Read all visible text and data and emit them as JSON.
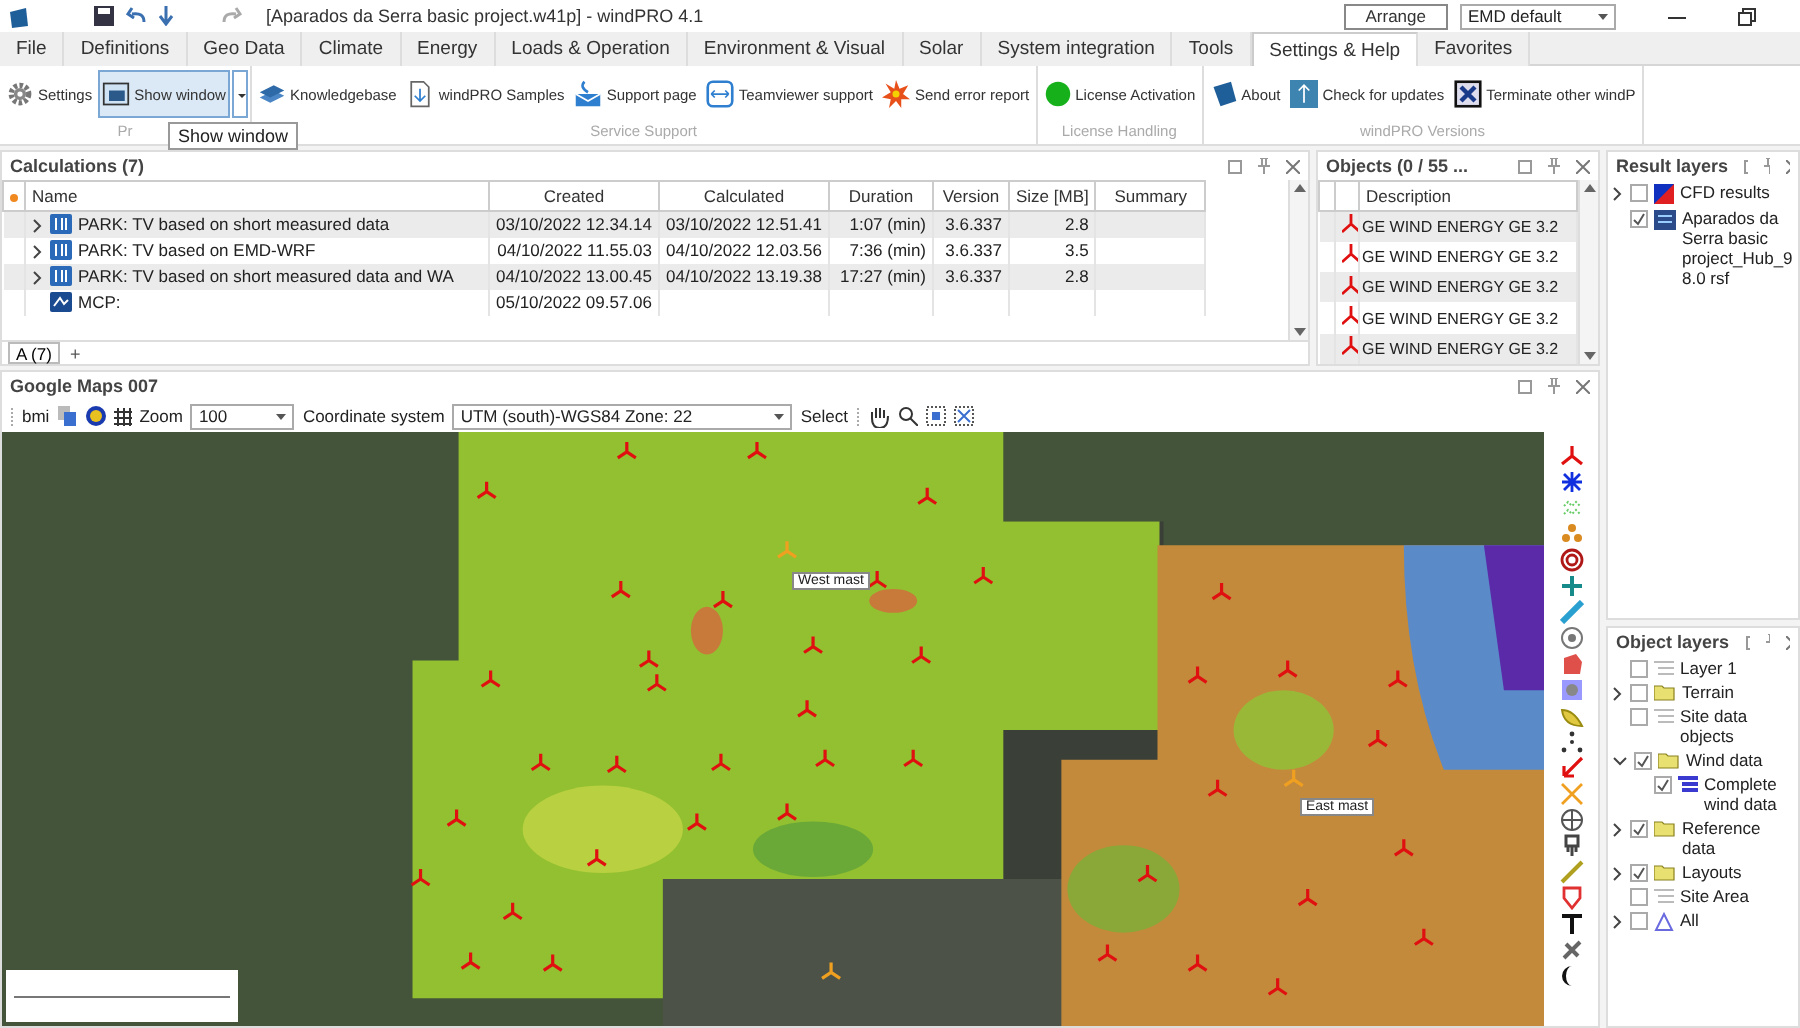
{
  "window": {
    "title": "[Aparados da Serra basic project.w41p] - windPRO 4.1",
    "arrange_button": "Arrange",
    "layout_select": "EMD default"
  },
  "menu_tabs": [
    {
      "label": "File",
      "selected": false
    },
    {
      "label": "Definitions",
      "selected": false
    },
    {
      "label": "Geo Data",
      "selected": false
    },
    {
      "label": "Climate",
      "selected": false
    },
    {
      "label": "Energy",
      "selected": false
    },
    {
      "label": "Loads & Operation",
      "selected": false
    },
    {
      "label": "Environment & Visual",
      "selected": false
    },
    {
      "label": "Solar",
      "selected": false
    },
    {
      "label": "System integration",
      "selected": false
    },
    {
      "label": "Tools",
      "selected": false
    },
    {
      "label": "Settings & Help",
      "selected": true
    },
    {
      "label": "Favorites",
      "selected": false
    }
  ],
  "ribbon_groups": [
    {
      "label": "Pr",
      "buttons": [
        {
          "label": "Settings",
          "hovered": false,
          "dropdown": false
        },
        {
          "label": "Show window",
          "hovered": true,
          "dropdown": true
        }
      ]
    },
    {
      "label": "Service Support",
      "buttons": [
        {
          "label": "Knowledgebase",
          "hovered": false,
          "dropdown": false
        },
        {
          "label": "windPRO Samples",
          "hovered": false,
          "dropdown": false
        },
        {
          "label": "Support page",
          "hovered": false,
          "dropdown": false
        },
        {
          "label": "Teamviewer support",
          "hovered": false,
          "dropdown": false
        },
        {
          "label": "Send error report",
          "hovered": false,
          "dropdown": false
        }
      ]
    },
    {
      "label": "License Handling",
      "buttons": [
        {
          "label": "License Activation",
          "hovered": false,
          "dropdown": false
        }
      ]
    },
    {
      "label": "windPRO Versions",
      "buttons": [
        {
          "label": "About",
          "hovered": false,
          "dropdown": false
        },
        {
          "label": "Check for updates",
          "hovered": false,
          "dropdown": false
        },
        {
          "label": "Terminate other windP",
          "hovered": false,
          "dropdown": false
        }
      ]
    }
  ],
  "tooltip": "Show window",
  "calculations": {
    "title": "Calculations (7)",
    "columns": [
      "Name",
      "Created",
      "Calculated",
      "Duration",
      "Version",
      "Size [MB]",
      "Summary"
    ],
    "rows": [
      {
        "kind": "park",
        "expanded": false,
        "name": "PARK: TV based on short measured data",
        "created": "03/10/2022 12.34.14",
        "calculated": "03/10/2022 12.51.41",
        "duration": "1:07 (min)",
        "version": "3.6.337",
        "size": "2.8"
      },
      {
        "kind": "park",
        "expanded": false,
        "name": "PARK: TV based on EMD-WRF",
        "created": "04/10/2022 11.55.03",
        "calculated": "04/10/2022 12.03.56",
        "duration": "7:36 (min)",
        "version": "3.6.337",
        "size": "3.5"
      },
      {
        "kind": "park",
        "expanded": false,
        "name": "PARK: TV based on short measured data and WA",
        "created": "04/10/2022 13.00.45",
        "calculated": "04/10/2022 13.19.38",
        "duration": "17:27 (min)",
        "version": "3.6.337",
        "size": "2.8"
      },
      {
        "kind": "mcp",
        "name": "MCP:",
        "created": "05/10/2022 09.57.06"
      }
    ],
    "sheet_tabs": [
      {
        "label": "A (7)",
        "selected": true
      }
    ],
    "add_sheet": "+"
  },
  "objects": {
    "title": "Objects (0 / 55 ...",
    "columns": [
      "Description"
    ],
    "rows": [
      {
        "description": "GE WIND ENERGY GE 3.2"
      },
      {
        "description": "GE WIND ENERGY GE 3.2"
      },
      {
        "description": "GE WIND ENERGY GE 3.2"
      },
      {
        "description": "GE WIND ENERGY GE 3.2"
      },
      {
        "description": "GE WIND ENERGY GE 3.2"
      }
    ]
  },
  "map": {
    "title": "Google Maps 007",
    "toolbar": {
      "source": "bmi",
      "zoom_label": "Zoom",
      "zoom_value": "100",
      "coord_label": "Coordinate system",
      "coord_value": "UTM (south)-WGS84 Zone: 22",
      "select_label": "Select"
    },
    "labels": [
      {
        "text": "West mast"
      },
      {
        "text": "East mast"
      }
    ]
  },
  "result_layers": {
    "title": "Result layers",
    "items": [
      {
        "kind": "cfd",
        "expanded": false,
        "checked": false,
        "label": "CFD results"
      },
      {
        "kind": "rsf",
        "checked": true,
        "label": "Aparados da Serra basic project_Hub_98.0 rsf"
      }
    ]
  },
  "object_layers": {
    "title": "Object layers",
    "items": [
      {
        "kind": "layer",
        "checked": false,
        "label": "Layer 1"
      },
      {
        "kind": "folder",
        "expanded": false,
        "checked": false,
        "label": "Terrain"
      },
      {
        "kind": "layer",
        "checked": false,
        "label": "Site data objects"
      },
      {
        "kind": "folder",
        "expanded": true,
        "checked": true,
        "label": "Wind data",
        "children": [
          {
            "kind": "data",
            "checked": true,
            "label": "Complete wind data"
          }
        ]
      },
      {
        "kind": "folder",
        "expanded": false,
        "checked": true,
        "label": "Reference data"
      },
      {
        "kind": "folder",
        "expanded": false,
        "checked": true,
        "label": "Layouts"
      },
      {
        "kind": "layer",
        "checked": false,
        "label": "Site Area"
      },
      {
        "kind": "all",
        "expanded": false,
        "checked": false,
        "label": "All"
      }
    ]
  }
}
